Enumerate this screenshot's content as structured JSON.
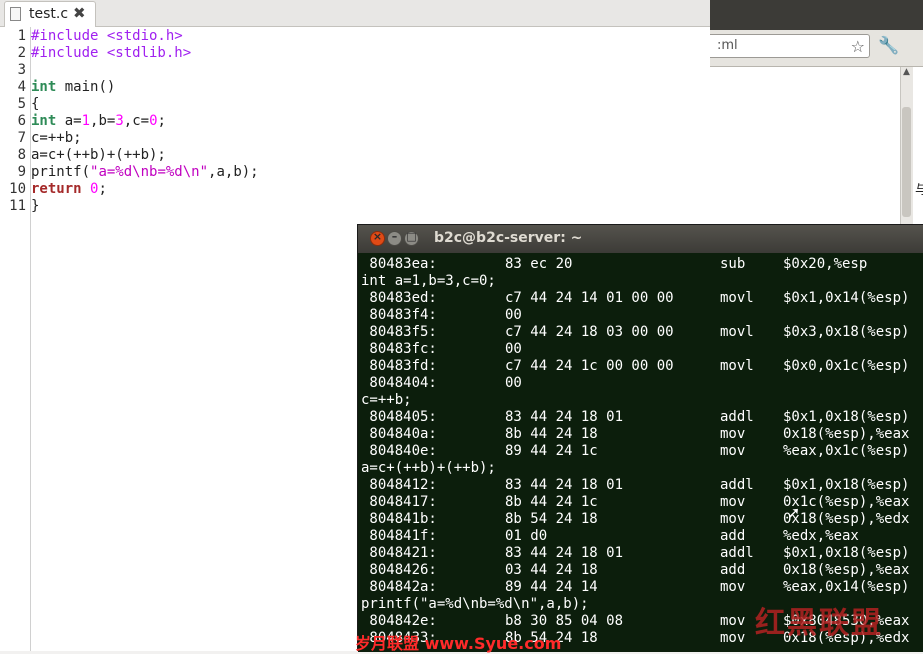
{
  "browser": {
    "url_fragment": ":ml",
    "side_glyph": "与"
  },
  "editor": {
    "tab_label": "test.c",
    "lines": [
      {
        "n": "1",
        "tokens": [
          {
            "c": "pp",
            "t": "#include <stdio.h>"
          }
        ]
      },
      {
        "n": "2",
        "tokens": [
          {
            "c": "pp",
            "t": "#include <stdlib.h>"
          }
        ]
      },
      {
        "n": "3",
        "tokens": []
      },
      {
        "n": "4",
        "tokens": [
          {
            "c": "kw",
            "t": "int"
          },
          {
            "c": "fn",
            "t": " main()"
          }
        ]
      },
      {
        "n": "5",
        "tokens": [
          {
            "c": "fn",
            "t": "{"
          }
        ]
      },
      {
        "n": "6",
        "tokens": [
          {
            "c": "kw",
            "t": "int"
          },
          {
            "c": "fn",
            "t": " a="
          },
          {
            "c": "num",
            "t": "1"
          },
          {
            "c": "fn",
            "t": ",b="
          },
          {
            "c": "num",
            "t": "3"
          },
          {
            "c": "fn",
            "t": ",c="
          },
          {
            "c": "num",
            "t": "0"
          },
          {
            "c": "fn",
            "t": ";"
          }
        ]
      },
      {
        "n": "7",
        "tokens": [
          {
            "c": "fn",
            "t": "c=++b;"
          }
        ]
      },
      {
        "n": "8",
        "tokens": [
          {
            "c": "fn",
            "t": "a=c+(++b)+(++b);"
          }
        ]
      },
      {
        "n": "9",
        "tokens": [
          {
            "c": "fn",
            "t": "printf("
          },
          {
            "c": "str",
            "t": "\"a=%d\\nb=%d\\n\""
          },
          {
            "c": "fn",
            "t": ",a,b);"
          }
        ]
      },
      {
        "n": "10",
        "tokens": [
          {
            "c": "kwr",
            "t": "return"
          },
          {
            "c": "fn",
            "t": " "
          },
          {
            "c": "num",
            "t": "0"
          },
          {
            "c": "fn",
            "t": ";"
          }
        ]
      },
      {
        "n": "11",
        "tokens": [
          {
            "c": "fn",
            "t": "}"
          }
        ]
      }
    ]
  },
  "terminal": {
    "title": "b2c@b2c-server: ~",
    "rows": [
      {
        "addr": " 80483ea:",
        "bytes": "83 ec 20",
        "op": "sub",
        "args": "$0x20,%esp"
      },
      {
        "src": "int a=1,b=3,c=0;"
      },
      {
        "addr": " 80483ed:",
        "bytes": "c7 44 24 14 01 00 00",
        "op": "movl",
        "args": "$0x1,0x14(%esp)"
      },
      {
        "addr": " 80483f4:",
        "bytes": "00",
        "op": "",
        "args": ""
      },
      {
        "addr": " 80483f5:",
        "bytes": "c7 44 24 18 03 00 00",
        "op": "movl",
        "args": "$0x3,0x18(%esp)"
      },
      {
        "addr": " 80483fc:",
        "bytes": "00",
        "op": "",
        "args": ""
      },
      {
        "addr": " 80483fd:",
        "bytes": "c7 44 24 1c 00 00 00",
        "op": "movl",
        "args": "$0x0,0x1c(%esp)"
      },
      {
        "addr": " 8048404:",
        "bytes": "00",
        "op": "",
        "args": ""
      },
      {
        "src": "c=++b;"
      },
      {
        "addr": " 8048405:",
        "bytes": "83 44 24 18 01",
        "op": "addl",
        "args": "$0x1,0x18(%esp)"
      },
      {
        "addr": " 804840a:",
        "bytes": "8b 44 24 18",
        "op": "mov",
        "args": "0x18(%esp),%eax"
      },
      {
        "addr": " 804840e:",
        "bytes": "89 44 24 1c",
        "op": "mov",
        "args": "%eax,0x1c(%esp)"
      },
      {
        "src": "a=c+(++b)+(++b);"
      },
      {
        "addr": " 8048412:",
        "bytes": "83 44 24 18 01",
        "op": "addl",
        "args": "$0x1,0x18(%esp)"
      },
      {
        "addr": " 8048417:",
        "bytes": "8b 44 24 1c",
        "op": "mov",
        "args": "0x1c(%esp),%eax"
      },
      {
        "addr": " 804841b:",
        "bytes": "8b 54 24 18",
        "op": "mov",
        "args": "0x18(%esp),%edx"
      },
      {
        "addr": " 804841f:",
        "bytes": "01 d0",
        "op": "add",
        "args": "%edx,%eax"
      },
      {
        "addr": " 8048421:",
        "bytes": "83 44 24 18 01",
        "op": "addl",
        "args": "$0x1,0x18(%esp)"
      },
      {
        "addr": " 8048426:",
        "bytes": "03 44 24 18",
        "op": "add",
        "args": "0x18(%esp),%eax"
      },
      {
        "addr": " 804842a:",
        "bytes": "89 44 24 14",
        "op": "mov",
        "args": "%eax,0x14(%esp)"
      },
      {
        "src": "printf(\"a=%d\\nb=%d\\n\",a,b);"
      },
      {
        "addr": " 804842e:",
        "bytes": "b8 30 85 04 08",
        "op": "mov",
        "args": "$0x8048530,%eax"
      },
      {
        "addr": " 8048433:",
        "bytes": "8b 54 24 18",
        "op": "mov",
        "args": "0x18(%esp),%edx"
      }
    ]
  },
  "watermark": {
    "left": "岁月联盟  www.Syue.com",
    "right": "红黑联盟"
  }
}
